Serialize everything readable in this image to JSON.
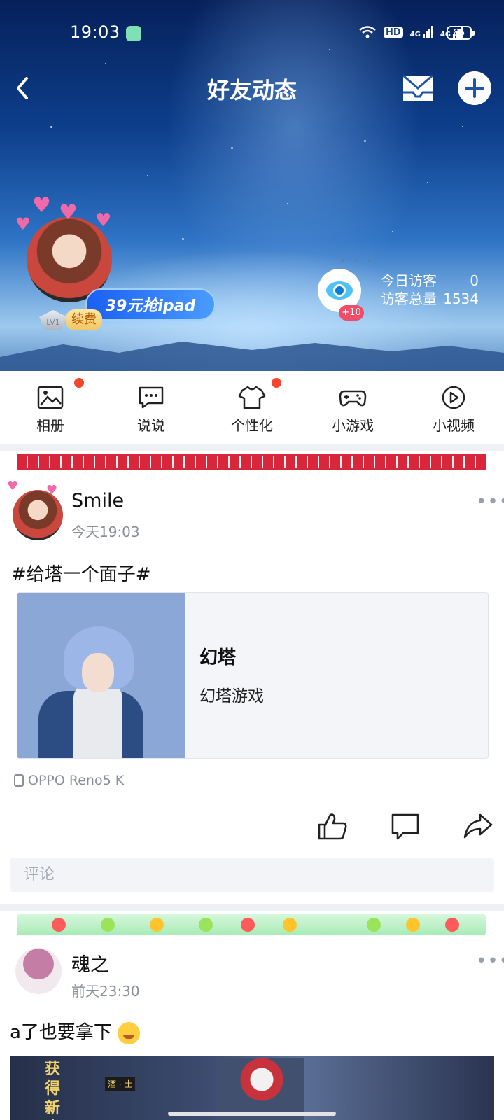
{
  "status_bar": {
    "time": "19:03",
    "battery": "85",
    "network_labels": [
      "HD",
      "4G",
      "4G"
    ]
  },
  "nav": {
    "title": "好友动态"
  },
  "profile": {
    "promo_label": "39元抢ipad",
    "level": "LV1",
    "renew_label": "续费",
    "visitor_badge": "+10",
    "today_visitors_label": "今日访客",
    "today_visitors_value": "0",
    "total_visitors_label": "访客总量",
    "total_visitors_value": "1534"
  },
  "shortcuts": [
    {
      "label": "相册",
      "icon": "photo-album-icon",
      "badge": true
    },
    {
      "label": "说说",
      "icon": "chat-bubble-icon",
      "badge": false
    },
    {
      "label": "个性化",
      "icon": "tshirt-icon",
      "badge": true
    },
    {
      "label": "小游戏",
      "icon": "gamepad-icon",
      "badge": false
    },
    {
      "label": "小视频",
      "icon": "play-circle-icon",
      "badge": false
    }
  ],
  "posts": [
    {
      "author": "Smile",
      "time": "今天19:03",
      "text": "#给塔一个面子#",
      "share": {
        "title": "幻塔",
        "subtitle": "幻塔游戏"
      },
      "device": "OPPO Reno5 K"
    },
    {
      "author": "魂之",
      "time": "前天23:30",
      "text": "a了也要拿下",
      "image_text": "获得新皮",
      "image_chip": "酒 · 士"
    }
  ],
  "comment_placeholder": "评论",
  "colors": {
    "badge_red": "#f5452f",
    "promo_blue": "#1b5ff2",
    "page_bg": "#ffffff",
    "separator": "#eef0f4"
  }
}
